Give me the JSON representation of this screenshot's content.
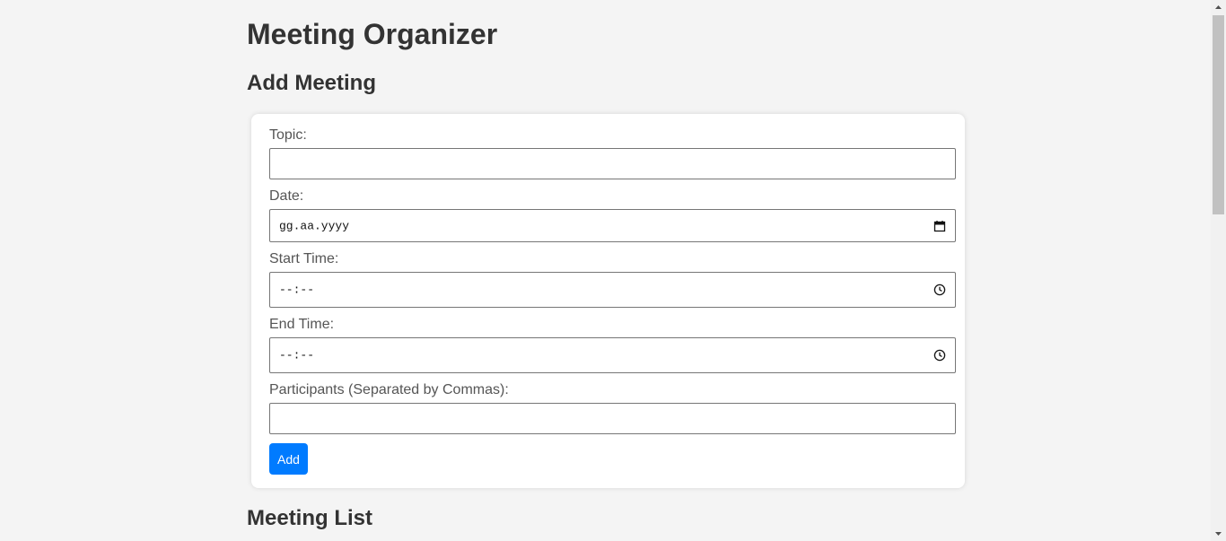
{
  "header": {
    "title": "Meeting Organizer"
  },
  "add_section": {
    "title": "Add Meeting",
    "fields": {
      "topic": {
        "label": "Topic:",
        "value": ""
      },
      "date": {
        "label": "Date:",
        "placeholder": "gg.aa.yyyy",
        "icon": "calendar-icon"
      },
      "start_time": {
        "label": "Start Time:",
        "placeholder": "--:--",
        "icon": "clock-icon"
      },
      "end_time": {
        "label": "End Time:",
        "placeholder": "--:--",
        "icon": "clock-icon"
      },
      "participants": {
        "label": "Participants (Separated by Commas):",
        "value": ""
      }
    },
    "add_button_label": "Add"
  },
  "list_section": {
    "title": "Meeting List"
  },
  "colors": {
    "background": "#f4f4f4",
    "card": "#ffffff",
    "accent": "#007bff",
    "text": "#333333",
    "label": "#555555"
  }
}
